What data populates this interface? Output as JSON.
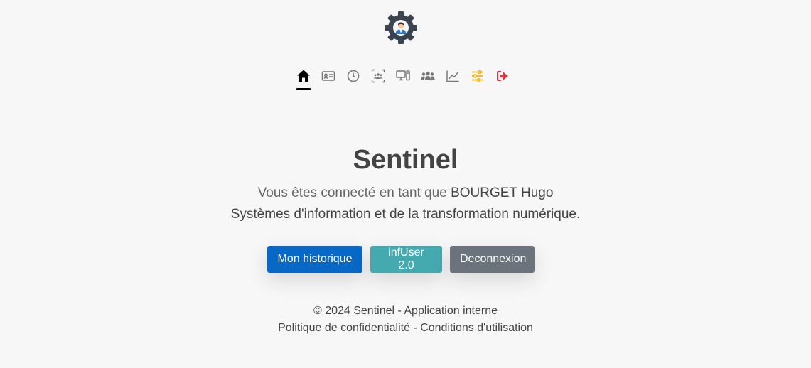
{
  "brand": {
    "logo_icon": "gear-person-logo-icon"
  },
  "nav": {
    "items": [
      {
        "name": "nav-home",
        "icon": "home-icon",
        "active": true
      },
      {
        "name": "nav-profile-card",
        "icon": "id-card-icon"
      },
      {
        "name": "nav-history",
        "icon": "clock-icon"
      },
      {
        "name": "nav-scan-users",
        "icon": "users-scan-icon"
      },
      {
        "name": "nav-devices",
        "icon": "desktop-icon"
      },
      {
        "name": "nav-groups",
        "icon": "users-group-icon"
      },
      {
        "name": "nav-stats",
        "icon": "line-chart-icon"
      },
      {
        "name": "nav-settings",
        "icon": "sliders-icon",
        "color": "#f2b51a"
      },
      {
        "name": "nav-logout",
        "icon": "logout-icon",
        "color": "#dc3545"
      }
    ]
  },
  "main": {
    "title": "Sentinel",
    "connected_prefix": "Vous êtes connecté en tant que",
    "user_name": "BOURGET Hugo",
    "department": "Systèmes d'information et de la transformation numérique."
  },
  "buttons": {
    "history": "Mon historique",
    "infuser": "infUser 2.0",
    "logout": "Deconnexion"
  },
  "footer": {
    "copyright": "© 2024 Sentinel - Application interne",
    "privacy": "Politique de confidentialité",
    "separator": " - ",
    "terms": "Conditions d'utilisation"
  },
  "colors": {
    "primary": "#0868c5",
    "info": "#45a9b0",
    "secondary": "#6b737c",
    "settings_icon": "#f2b51a",
    "logout_icon": "#dc3545"
  }
}
